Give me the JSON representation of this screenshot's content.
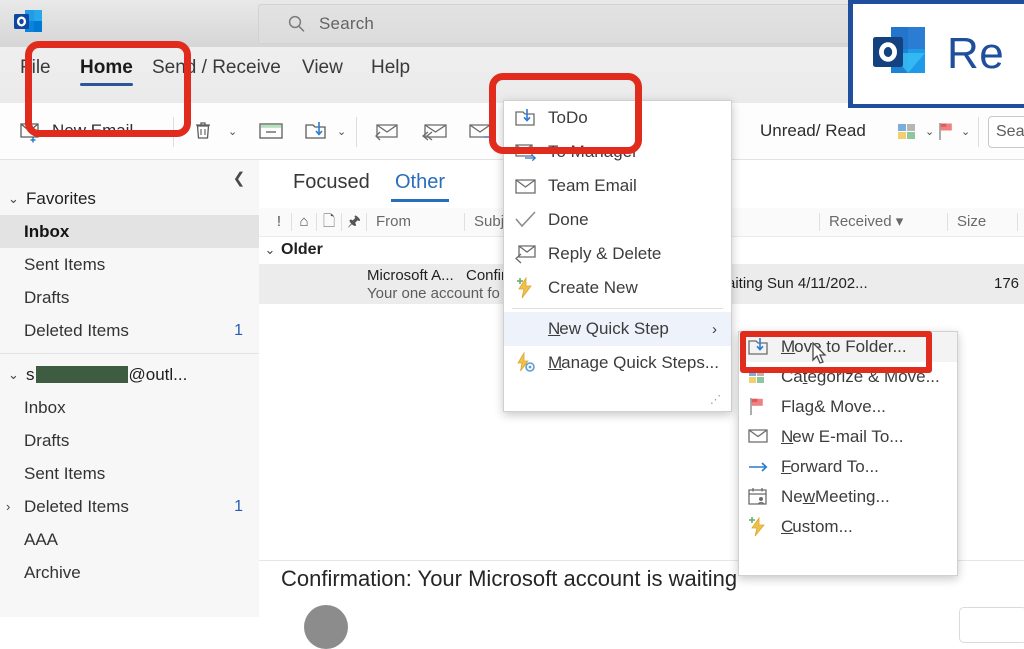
{
  "window": {
    "app_icon": "outlook-logo-icon"
  },
  "search": {
    "placeholder": "Search",
    "icon": "search-icon"
  },
  "ribbon_tabs": [
    {
      "label": "File",
      "selected": false
    },
    {
      "label": "Home",
      "selected": true
    },
    {
      "label": "Send / Receive",
      "selected": false
    },
    {
      "label": "View",
      "selected": false
    },
    {
      "label": "Help",
      "selected": false
    }
  ],
  "ribbon": {
    "new_email": {
      "label": "New Email",
      "icon": "new-email-icon",
      "chevron": "⌄"
    },
    "delete": {
      "icon": "trash-icon",
      "chevron": "⌄"
    },
    "archive": {
      "icon": "archive-icon"
    },
    "move": {
      "icon": "move-to-folder-icon",
      "chevron": "⌄"
    },
    "reply": {
      "icon": "reply-icon"
    },
    "reply_all": {
      "icon": "reply-all-icon"
    },
    "forward": {
      "icon": "forward-icon"
    },
    "unread_read": {
      "label": "Unread/ Read",
      "icon": "unread-read-icon"
    },
    "categorize": {
      "icon": "categorize-icon",
      "chevron": "⌄"
    },
    "follow_up": {
      "icon": "flag-icon",
      "chevron": "⌄"
    },
    "search_people": {
      "label": "Sea",
      "icon": "search-people-icon"
    }
  },
  "navpane": {
    "collapse_icon": "chevron-left-icon",
    "favorites": {
      "label": "Favorites",
      "twisty": "⌄",
      "items": [
        {
          "label": "Inbox",
          "count": "",
          "selected": true
        },
        {
          "label": "Sent Items",
          "count": "",
          "selected": false
        },
        {
          "label": "Drafts",
          "count": "",
          "selected": false
        },
        {
          "label": "Deleted Items",
          "count": "1",
          "selected": false
        }
      ]
    },
    "account": {
      "label_prefix": "s",
      "label_suffix": "@outl...",
      "twisty": "⌄",
      "items": [
        {
          "label": "Inbox",
          "count": "",
          "twisty": ""
        },
        {
          "label": "Drafts",
          "count": "",
          "twisty": ""
        },
        {
          "label": "Sent Items",
          "count": "",
          "twisty": ""
        },
        {
          "label": "Deleted Items",
          "count": "1",
          "twisty": "›"
        },
        {
          "label": "AAA",
          "count": "",
          "twisty": ""
        },
        {
          "label": "Archive",
          "count": "",
          "twisty": ""
        }
      ]
    }
  },
  "list": {
    "focus_tabs": [
      {
        "label": "Focused",
        "selected": false
      },
      {
        "label": "Other",
        "selected": true
      }
    ],
    "columns": [
      {
        "label": "!",
        "type": "icon"
      },
      {
        "label": "⌂",
        "type": "icon"
      },
      {
        "label": "🗋",
        "type": "icon"
      },
      {
        "label": "🖈",
        "type": "icon"
      },
      {
        "label": "From",
        "type": "text"
      },
      {
        "label": "Subjec",
        "type": "text"
      },
      {
        "label": "Received ▾",
        "type": "text"
      },
      {
        "label": "Size",
        "type": "text"
      }
    ],
    "group": {
      "label": "Older",
      "twisty": "⌄"
    },
    "rows": [
      {
        "from": "Microsoft A...",
        "subject": "Confirm",
        "preview": "Your one account fo",
        "received_partial": "aiting",
        "date": "Sun 4/11/202...",
        "size": "176"
      }
    ],
    "splitter": ": ."
  },
  "reading_pane": {
    "subject": "Confirmation: Your Microsoft account is waiting"
  },
  "quick_steps_menu": {
    "items": [
      {
        "label": "ToDo",
        "icon": "move-to-folder-icon",
        "highlighted": false
      },
      {
        "label": "To Manager",
        "icon": "forward-mail-icon",
        "highlighted": false
      },
      {
        "label": "Team Email",
        "icon": "mail-icon",
        "highlighted": false
      },
      {
        "label": "Done",
        "icon": "check-icon",
        "highlighted": false
      },
      {
        "label": "Reply & Delete",
        "icon": "reply-delete-icon",
        "highlighted": false
      },
      {
        "label": "Create New",
        "icon": "lightning-plus-icon",
        "highlighted": false
      }
    ],
    "footer_items": [
      {
        "label": "New Quick Step",
        "accel": "N",
        "icon": "",
        "submenu_arrow": "›",
        "highlighted": true
      },
      {
        "label": "Manage Quick Steps...",
        "accel": "M",
        "icon": "lightning-gear-icon",
        "submenu_arrow": "",
        "highlighted": false
      }
    ],
    "grip": "⋰"
  },
  "new_quick_step_submenu": {
    "items": [
      {
        "label": "Move to Folder...",
        "accel": "M",
        "icon": "move-to-folder-icon",
        "selected": true
      },
      {
        "label": "Categorize & Move...",
        "accel": "t",
        "icon": "categorize-icon",
        "selected": false
      },
      {
        "label": "Flag & Move...",
        "accel": "g",
        "icon": "flag-icon",
        "selected": false
      },
      {
        "label": "New E-mail To...",
        "accel": "N",
        "icon": "mail-icon",
        "selected": false
      },
      {
        "label": "Forward To...",
        "accel": "F",
        "icon": "forward-arrow-icon",
        "selected": false
      },
      {
        "label": "New Meeting...",
        "accel": "w",
        "icon": "new-meeting-icon",
        "selected": false
      },
      {
        "label": "Custom...",
        "accel": "C",
        "icon": "lightning-plus-icon",
        "selected": false
      }
    ]
  },
  "branding_overlay": {
    "text": "Re",
    "icon": "outlook-logo-icon",
    "border_color": "#1f4e9c",
    "text_color": "#1f4e9c"
  },
  "annotations": {
    "color": "#e02b1d",
    "boxes": [
      {
        "name": "home-tab-highlight",
        "target": "Home"
      },
      {
        "name": "todo-quickstep-highlight",
        "target": "ToDo"
      },
      {
        "name": "move-to-folder-highlight",
        "target": "Move to Folder..."
      }
    ]
  },
  "colors": {
    "accent_blue": "#2a6ebb",
    "tab_underline": "#2b579a",
    "count_blue": "#2a5db0",
    "annotation_red": "#e02b1d",
    "redaction": "#3d5c42"
  }
}
